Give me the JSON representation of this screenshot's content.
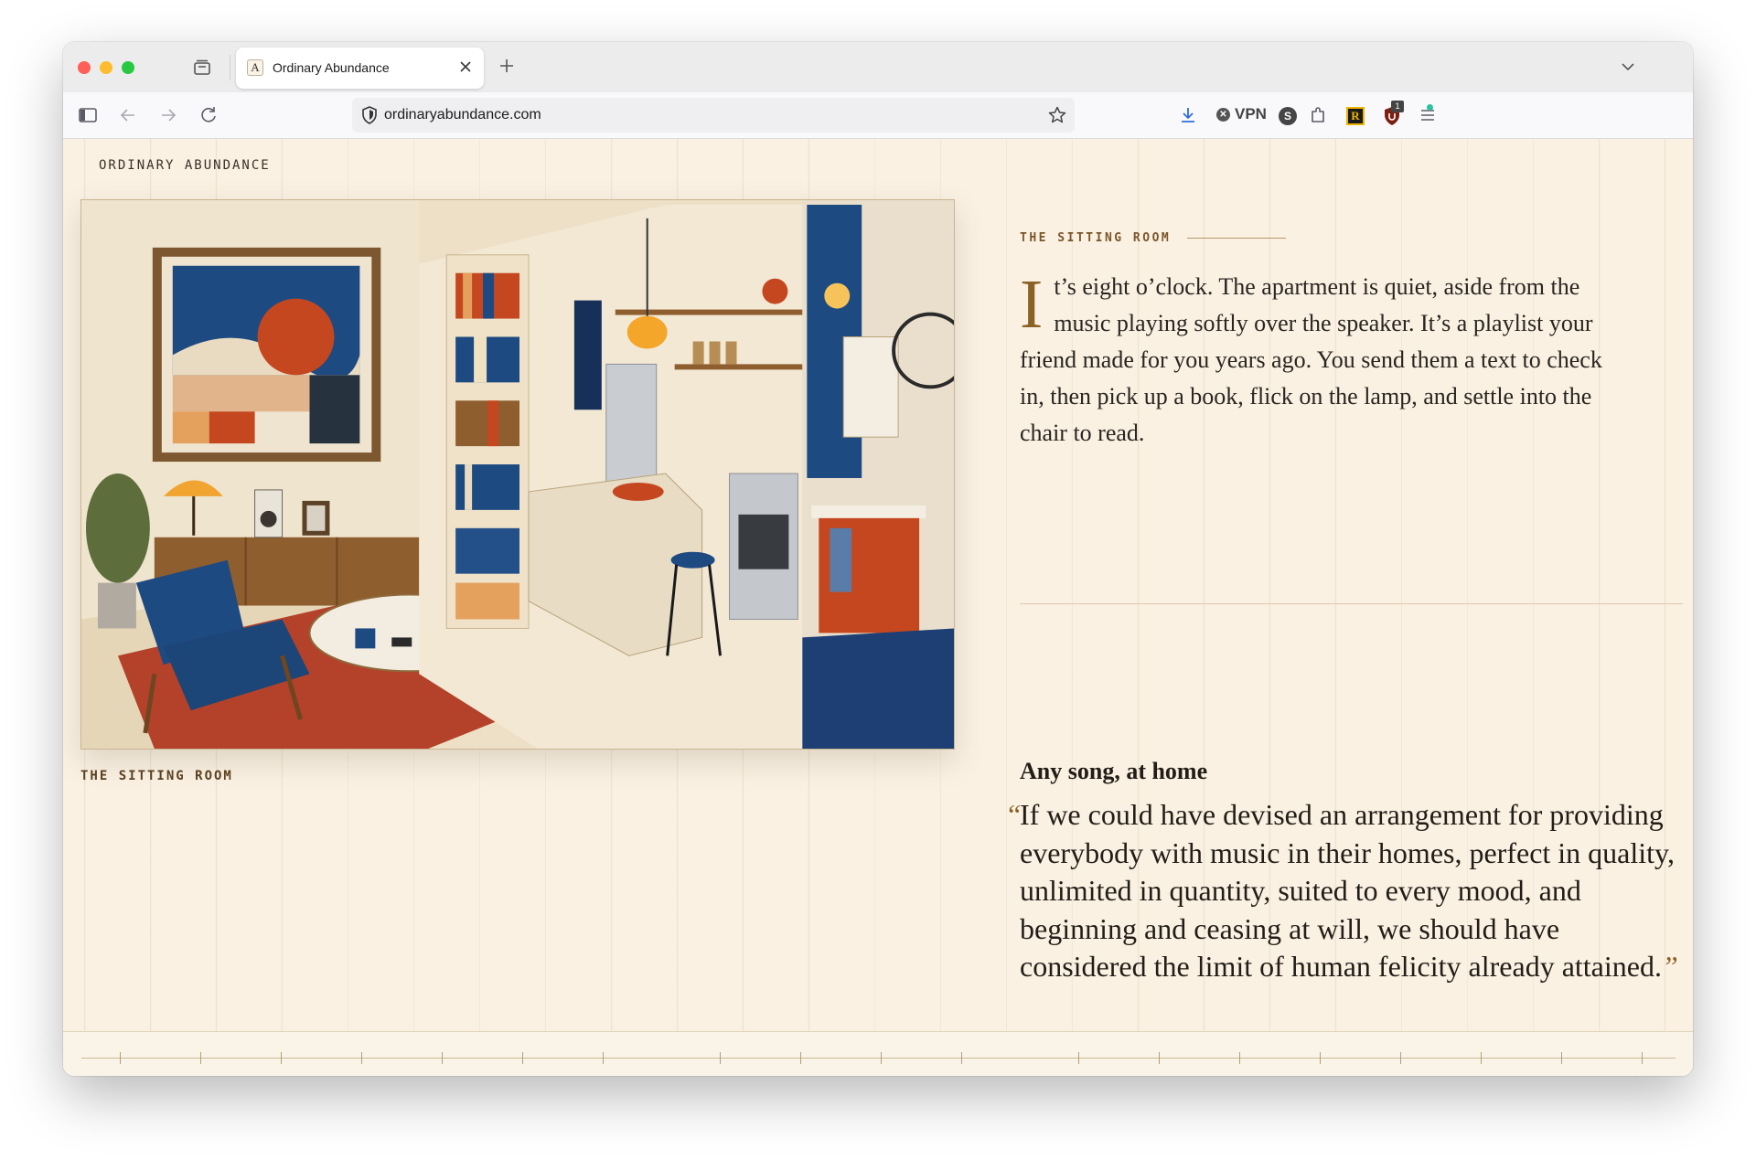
{
  "browser": {
    "tab_title": "Ordinary Abundance",
    "favicon_letter": "A",
    "url": "ordinaryabundance.com",
    "vpn_label": "VPN",
    "ext_s_label": "S",
    "ext_r_label": "R",
    "ext_badge": "1"
  },
  "page": {
    "brand": "ORDINARY ABUNDANCE",
    "figure_caption": "THE SITTING ROOM",
    "section_label": "THE SITTING ROOM",
    "intro_dropcap": "I",
    "intro_text": "t’s eight o’clock. The apartment is quiet, aside from the music playing softly over the speaker. It’s a playlist your friend made for you years ago. You send them a text to check in, then pick up a book, flick on the lamp, and settle into the chair to read.",
    "song_title": "Any song, at home",
    "quote_open": "“",
    "quote_text": "If we could have devised an arrangement for providing everybody with music in their homes, perfect in quality, unlimited in quantity, suited to every mood, and beginning and ceasing at will, we should have considered the limit of human felicity already attained.",
    "quote_close": "”"
  },
  "colors": {
    "page_bg": "#faf1e3",
    "accent_brown": "#8a6226",
    "ink": "#231d17",
    "navy": "#1e4a82",
    "rust": "#c5471f"
  },
  "icons": [
    "tab-overview-icon",
    "close-icon",
    "plus-icon",
    "chevron-down-icon",
    "sidebar-icon",
    "back-arrow-icon",
    "forward-arrow-icon",
    "reload-icon",
    "shield-icon",
    "star-icon",
    "download-icon",
    "puzzle-icon",
    "menu-icon"
  ]
}
